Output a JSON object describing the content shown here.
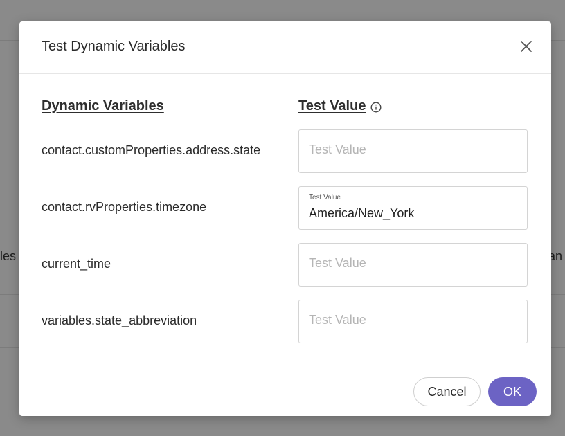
{
  "background": {
    "left_fragment": "les l",
    "right_fragment": "ran"
  },
  "dialog": {
    "title": "Test Dynamic Variables",
    "close_icon": "close-icon"
  },
  "columns": {
    "variables_header": "Dynamic Variables",
    "value_header": "Test Value",
    "info_icon": "info-icon"
  },
  "rows": [
    {
      "variable": "contact.customProperties.address.state",
      "placeholder": "Test Value",
      "value": ""
    },
    {
      "variable": "contact.rvProperties.timezone",
      "placeholder": "Test Value",
      "label": "Test Value",
      "value": "America/New_York"
    },
    {
      "variable": "current_time",
      "placeholder": "Test Value",
      "value": ""
    },
    {
      "variable": "variables.state_abbreviation",
      "placeholder": "Test Value",
      "value": ""
    }
  ],
  "footer": {
    "cancel_label": "Cancel",
    "ok_label": "OK"
  },
  "colors": {
    "accent": "#6c63c4",
    "backdrop": "#8a8a8a"
  }
}
